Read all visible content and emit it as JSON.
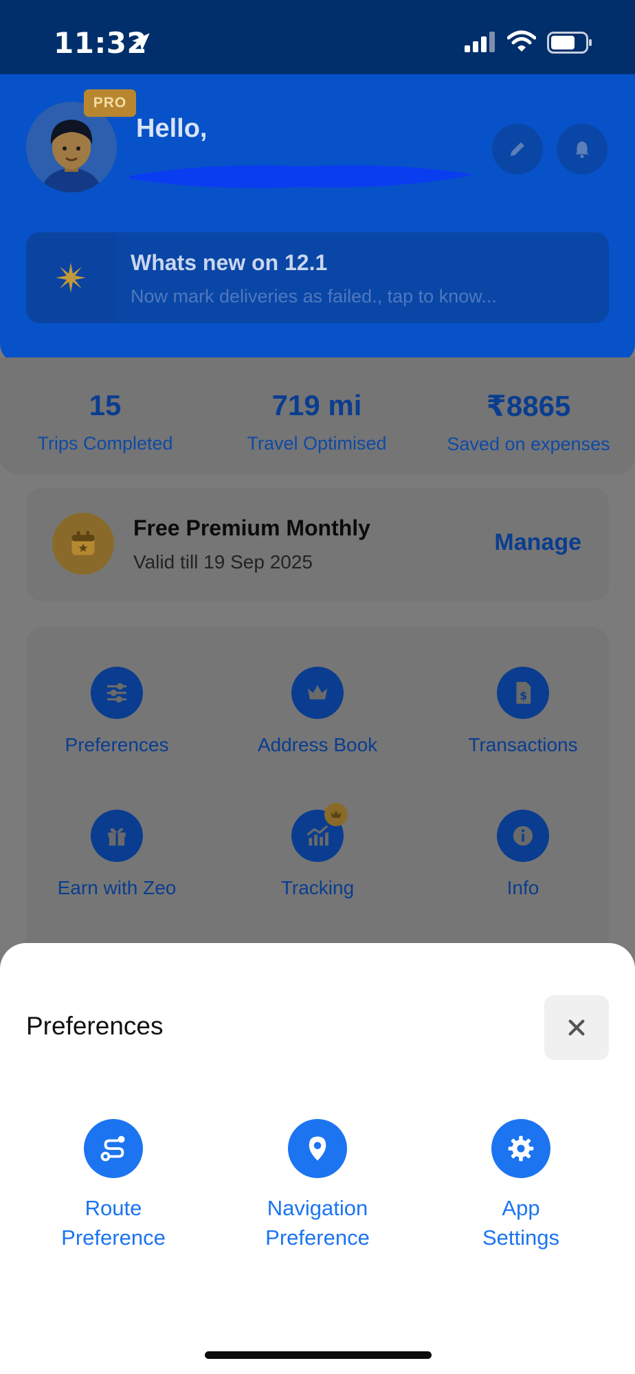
{
  "status_bar": {
    "time": "11:32"
  },
  "header": {
    "pro_badge": "PRO",
    "greeting": "Hello,",
    "whats_new": {
      "title": "Whats new on 12.1",
      "subtitle": "Now mark deliveries as failed., tap to know..."
    }
  },
  "stats": [
    {
      "value": "15",
      "label": "Trips Completed"
    },
    {
      "value": "719 mi",
      "label": "Travel Optimised"
    },
    {
      "value": "₹8865",
      "label": "Saved on expenses"
    }
  ],
  "plan": {
    "title": "Free Premium Monthly",
    "valid": "Valid till 19 Sep 2025",
    "manage": "Manage"
  },
  "menu": [
    {
      "label": "Preferences",
      "icon": "sliders-icon"
    },
    {
      "label": "Address Book",
      "icon": "crown-icon"
    },
    {
      "label": "Transactions",
      "icon": "receipt-icon"
    },
    {
      "label": "Earn with Zeo",
      "icon": "gift-icon"
    },
    {
      "label": "Tracking",
      "icon": "chart-icon"
    },
    {
      "label": "Info",
      "icon": "info-icon"
    }
  ],
  "sheet": {
    "title": "Preferences",
    "items": [
      {
        "line1": "Route",
        "line2": "Preference",
        "icon": "route-icon"
      },
      {
        "line1": "Navigation",
        "line2": "Preference",
        "icon": "location-pin-icon"
      },
      {
        "line1": "App",
        "line2": "Settings",
        "icon": "gear-icon"
      }
    ]
  },
  "colors": {
    "accent": "#1c74f0",
    "header_blue": "#0752c8",
    "status_bar": "#002f6b",
    "gold": "#b8862f"
  }
}
